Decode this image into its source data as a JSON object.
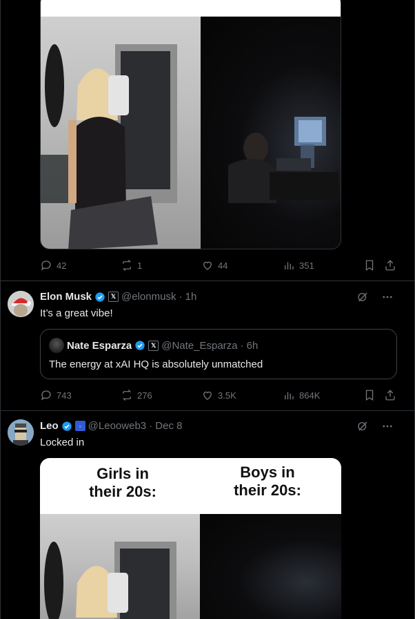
{
  "top_post_actions": {
    "replies": "42",
    "reposts": "1",
    "likes": "44",
    "views": "351"
  },
  "tweet1": {
    "name": "Elon Musk",
    "handle": "@elonmusk",
    "time": "· 1h",
    "text": "It’s a great vibe!",
    "quote": {
      "name": "Nate Esparza",
      "handle": "@Nate_Esparza",
      "time": "· 6h",
      "text": "The energy at xAI HQ is absolutely unmatched"
    },
    "actions": {
      "replies": "743",
      "reposts": "276",
      "likes": "3.5K",
      "views": "864K"
    }
  },
  "tweet2": {
    "name": "Leo",
    "handle": "@Leooweb3",
    "time": "· Dec 8",
    "text": "Locked in",
    "meme": {
      "left_label": "Girls in\ntheir 20s:",
      "right_label": "Boys in\ntheir 20s:"
    }
  },
  "colors": {
    "verified": "#1d9bf0",
    "muted": "#71767b",
    "border": "#2f3336"
  },
  "icons": [
    "reply-icon",
    "repost-icon",
    "like-icon",
    "views-icon",
    "bookmark-icon",
    "share-icon",
    "grok-icon",
    "more-icon",
    "verified-badge-icon",
    "x-affiliate-icon"
  ]
}
